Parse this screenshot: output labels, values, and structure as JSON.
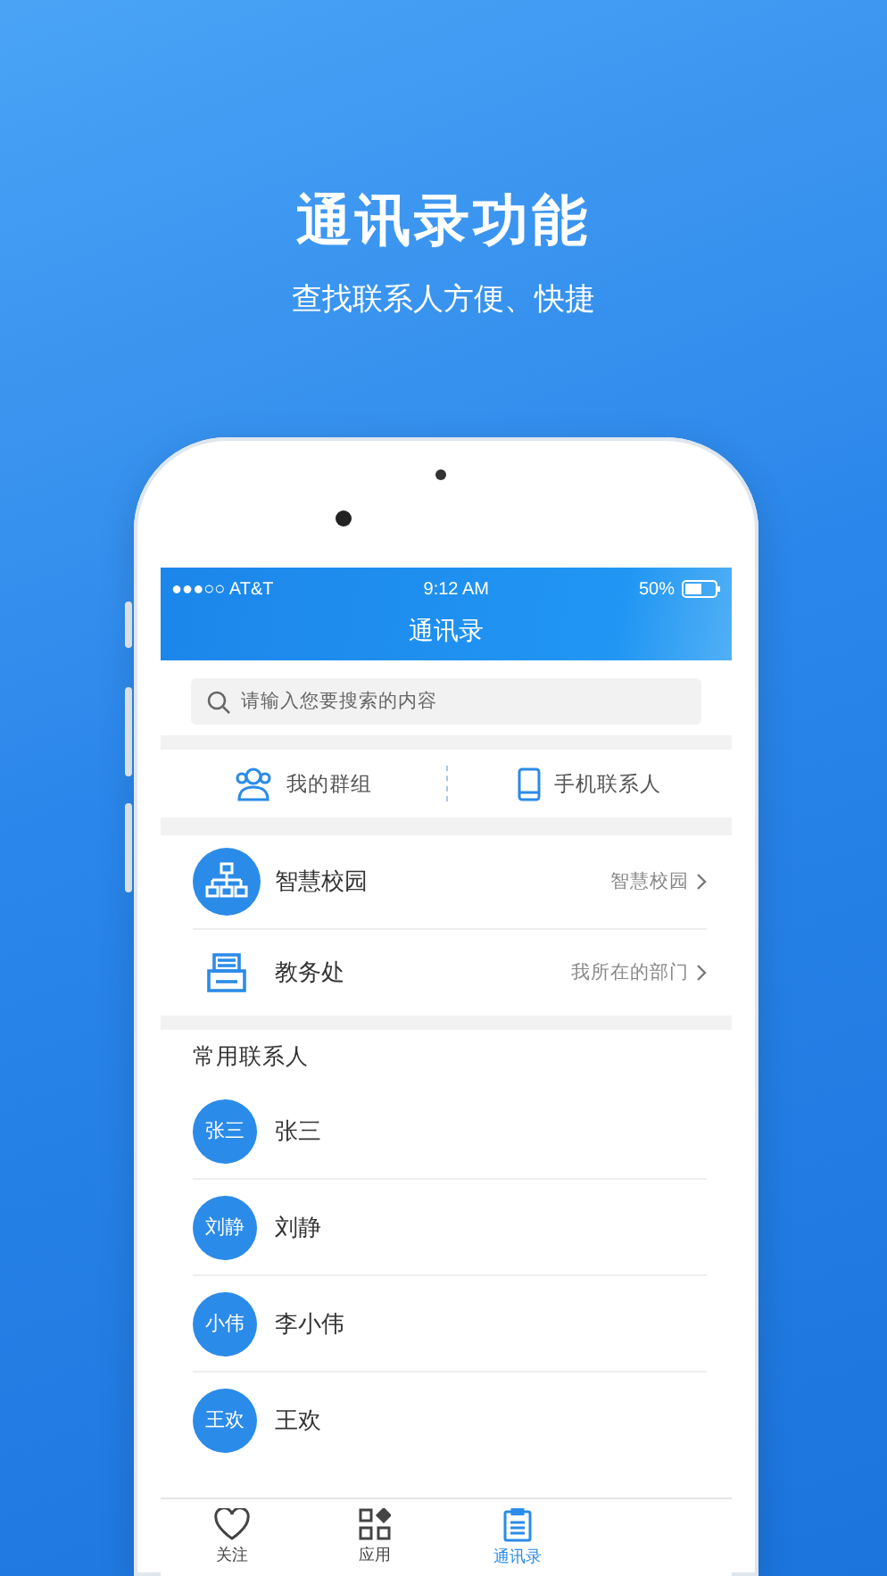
{
  "headline": "通讯录功能",
  "subheadline": "查找联系人方便、快捷",
  "status_bar": {
    "carrier": "●●●○○ AT&T",
    "time": "9:12 AM",
    "battery": "50%"
  },
  "title": "通讯录",
  "search": {
    "placeholder": "请输入您要搜索的内容"
  },
  "shortcuts": [
    {
      "kind": "group",
      "label": "我的群组"
    },
    {
      "kind": "phone",
      "label": "手机联系人"
    }
  ],
  "org_rows": [
    {
      "kind": "org",
      "label": "智慧校园",
      "detail": "智慧校园"
    },
    {
      "kind": "dept",
      "label": "教务处",
      "detail": "我所在的部门"
    }
  ],
  "section_title": "常用联系人",
  "contacts": [
    {
      "avatar": "张三",
      "name": "张三"
    },
    {
      "avatar": "刘静",
      "name": "刘静"
    },
    {
      "avatar": "小伟",
      "name": "李小伟"
    },
    {
      "avatar": "王欢",
      "name": "王欢"
    }
  ],
  "tab_bar": [
    {
      "kind": "heart",
      "label": "关注",
      "selected": false
    },
    {
      "kind": "apps",
      "label": "应用",
      "selected": false
    },
    {
      "kind": "contacts",
      "label": "通讯录",
      "selected": true
    }
  ]
}
